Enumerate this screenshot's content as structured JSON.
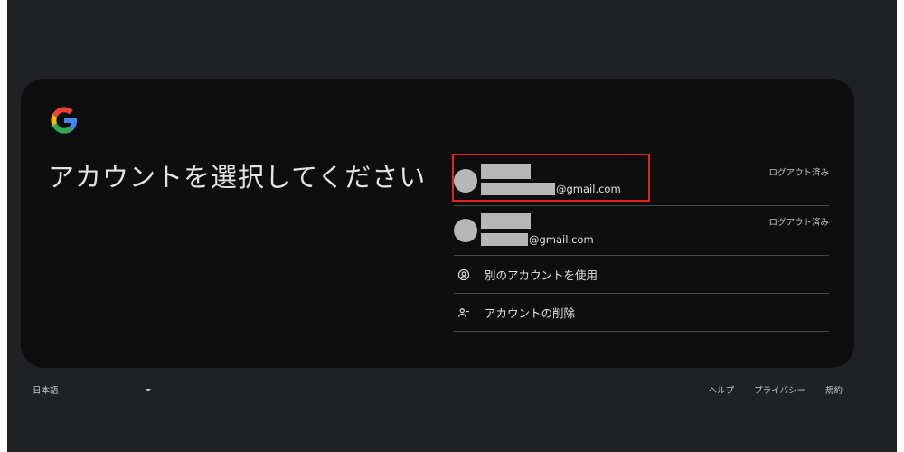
{
  "signin": {
    "heading": "アカウントを選択してください",
    "accounts": [
      {
        "email_domain": "@gmail.com",
        "status": "ログアウト済み",
        "highlighted": true
      },
      {
        "email_domain": "@gmail.com",
        "status": "ログアウト済み",
        "highlighted": false
      }
    ],
    "actions": [
      {
        "icon": "account-circle-icon",
        "label": "別のアカウントを使用"
      },
      {
        "icon": "person-remove-icon",
        "label": "アカウントの削除"
      }
    ]
  },
  "footer": {
    "language": "日本語",
    "links": [
      "ヘルプ",
      "プライバシー",
      "規約"
    ]
  },
  "colors": {
    "page_background": "#202124",
    "card_background": "#0e0e0e",
    "divider": "#444746",
    "highlight_border": "#e5231d",
    "redaction": "#b7b7b7"
  }
}
